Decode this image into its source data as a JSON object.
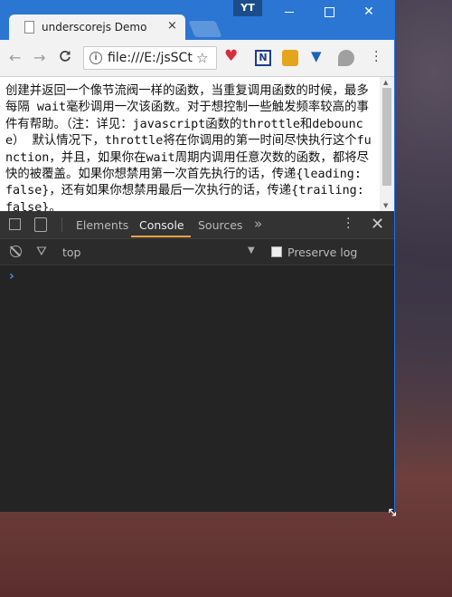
{
  "browser": {
    "tab_title": "underscorejs Demo",
    "tab_close": "×",
    "profile_badge": "YT",
    "url": "file:///E:/jsSCt",
    "back_glyph": "←",
    "forward_glyph": "→",
    "reload_glyph": "C"
  },
  "page": {
    "text": "创建并返回一个像节流阀一样的函数，当重复调用函数的时候，最多每隔 wait毫秒调用一次该函数。对于想控制一些触发频率较高的事件有帮助。（注：详见：javascript函数的throttle和debounce） 默认情况下，throttle将在你调用的第一时间尽快执行这个function，并且，如果你在wait周期内调用任意次数的函数，都将尽快的被覆盖。如果你想禁用第一次首先执行的话，传递{leading: false}，还有如果你想禁用最后一次执行的话，传递{trailing: false}。"
  },
  "devtools": {
    "tabs": [
      "Elements",
      "Console",
      "Sources"
    ],
    "more": "»",
    "context": "top",
    "preserve_log": "Preserve log",
    "prompt": "›",
    "close": "✕"
  },
  "icons": {
    "ext1": "heart-extension-icon",
    "ext2": "n-extension-icon",
    "ext3": "extension-icon",
    "ext4": "shield-extension-icon",
    "ext5": "leaf-extension-icon"
  }
}
